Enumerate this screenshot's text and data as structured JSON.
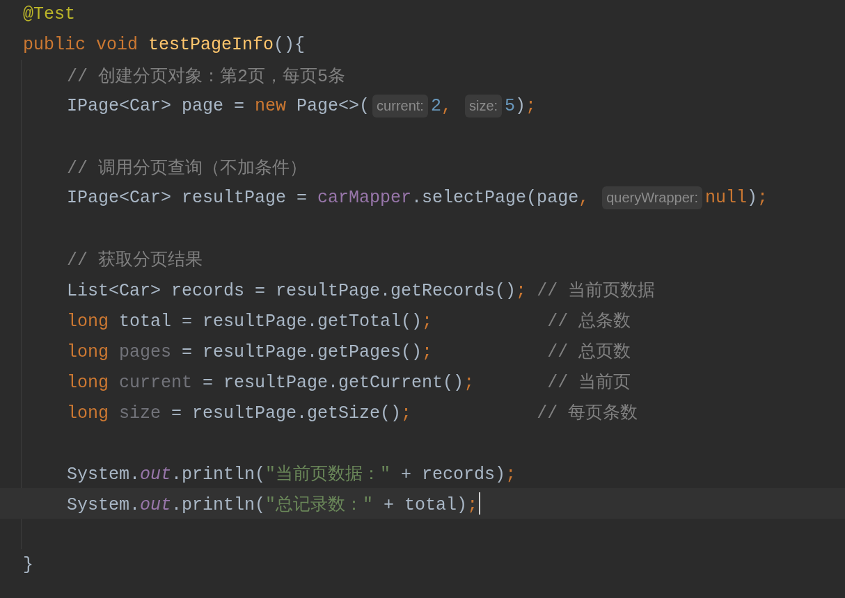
{
  "editor": {
    "lines": [
      {
        "kind": "code",
        "tokens": [
          {
            "kind": "annotation",
            "text": "@Test"
          }
        ]
      },
      {
        "kind": "code",
        "tokens": [
          {
            "kind": "keyword",
            "text": "public void "
          },
          {
            "kind": "method",
            "text": "testPageInfo"
          },
          {
            "kind": "plain",
            "text": "(){"
          }
        ],
        "children": [
          {
            "kind": "code",
            "tokens": [
              {
                "kind": "comment",
                "text": "// 创建分页对象：第2页，每页5条"
              }
            ]
          },
          {
            "kind": "code",
            "tokens": [
              {
                "kind": "plain",
                "text": "IPage<Car> page = "
              },
              {
                "kind": "keyword",
                "text": "new "
              },
              {
                "kind": "plain",
                "text": "Page<>("
              },
              {
                "kind": "hint",
                "text": "current:"
              },
              {
                "kind": "number",
                "text": "2"
              },
              {
                "kind": "punct",
                "text": ", "
              },
              {
                "kind": "hint",
                "text": "size:"
              },
              {
                "kind": "number",
                "text": "5"
              },
              {
                "kind": "plain",
                "text": ")"
              },
              {
                "kind": "punct",
                "text": ";"
              }
            ]
          },
          {
            "kind": "blank"
          },
          {
            "kind": "code",
            "tokens": [
              {
                "kind": "comment",
                "text": "// 调用分页查询（不加条件）"
              }
            ]
          },
          {
            "kind": "code",
            "tokens": [
              {
                "kind": "plain",
                "text": "IPage<Car> resultPage = "
              },
              {
                "kind": "member",
                "text": "carMapper"
              },
              {
                "kind": "plain",
                "text": ".selectPage(page"
              },
              {
                "kind": "punct",
                "text": ", "
              },
              {
                "kind": "hint",
                "text": "queryWrapper:"
              },
              {
                "kind": "keyword",
                "text": "null"
              },
              {
                "kind": "plain",
                "text": ")"
              },
              {
                "kind": "punct",
                "text": ";"
              }
            ]
          },
          {
            "kind": "blank"
          },
          {
            "kind": "code",
            "tokens": [
              {
                "kind": "comment",
                "text": "// 获取分页结果"
              }
            ]
          },
          {
            "kind": "code",
            "tokens": [
              {
                "kind": "plain",
                "text": "List<Car> records = resultPage.getRecords()"
              },
              {
                "kind": "punct",
                "text": "; "
              },
              {
                "kind": "comment",
                "text": "// 当前页数据"
              }
            ]
          },
          {
            "kind": "code",
            "tokens": [
              {
                "kind": "keyword",
                "text": "long "
              },
              {
                "kind": "plain",
                "text": "total = resultPage.getTotal()"
              },
              {
                "kind": "punct",
                "text": ";           "
              },
              {
                "kind": "comment",
                "text": "// 总条数"
              }
            ]
          },
          {
            "kind": "code",
            "tokens": [
              {
                "kind": "keyword",
                "text": "long "
              },
              {
                "kind": "unused",
                "text": "pages"
              },
              {
                "kind": "plain",
                "text": " = resultPage.getPages()"
              },
              {
                "kind": "punct",
                "text": ";           "
              },
              {
                "kind": "comment",
                "text": "// 总页数"
              }
            ]
          },
          {
            "kind": "code",
            "tokens": [
              {
                "kind": "keyword",
                "text": "long "
              },
              {
                "kind": "unused",
                "text": "current"
              },
              {
                "kind": "plain",
                "text": " = resultPage.getCurrent()"
              },
              {
                "kind": "punct",
                "text": ";       "
              },
              {
                "kind": "comment",
                "text": "// 当前页"
              }
            ]
          },
          {
            "kind": "code",
            "tokens": [
              {
                "kind": "keyword",
                "text": "long "
              },
              {
                "kind": "unused",
                "text": "size"
              },
              {
                "kind": "plain",
                "text": " = resultPage.getSize()"
              },
              {
                "kind": "punct",
                "text": ";            "
              },
              {
                "kind": "comment",
                "text": "// 每页条数"
              }
            ]
          },
          {
            "kind": "blank"
          },
          {
            "kind": "code",
            "tokens": [
              {
                "kind": "plain",
                "text": "System."
              },
              {
                "kind": "field",
                "text": "out"
              },
              {
                "kind": "plain",
                "text": ".println("
              },
              {
                "kind": "string",
                "text": "\"当前页数据：\""
              },
              {
                "kind": "plain",
                "text": " + records)"
              },
              {
                "kind": "punct",
                "text": ";"
              }
            ]
          },
          {
            "kind": "code",
            "current": true,
            "tokens": [
              {
                "kind": "plain",
                "text": "System."
              },
              {
                "kind": "field",
                "text": "out"
              },
              {
                "kind": "plain",
                "text": ".println("
              },
              {
                "kind": "string",
                "text": "\"总记录数：\""
              },
              {
                "kind": "plain",
                "text": " + total)"
              },
              {
                "kind": "punct",
                "text": ";"
              }
            ]
          },
          {
            "kind": "blank"
          }
        ]
      },
      {
        "kind": "code",
        "tokens": [
          {
            "kind": "plain",
            "text": "}"
          }
        ]
      }
    ]
  }
}
